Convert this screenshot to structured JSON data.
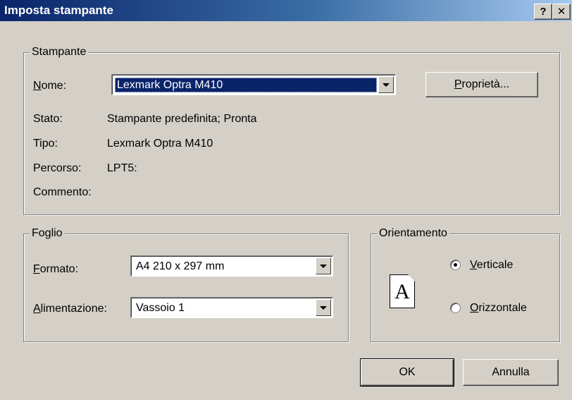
{
  "window": {
    "title": "Imposta stampante",
    "help_label": "?",
    "close_label": "✕"
  },
  "printer": {
    "group_label": "Stampante",
    "name_label_first": "N",
    "name_label_rest": "ome:",
    "name_value": "Lexmark Optra M410",
    "properties_first": "P",
    "properties_rest": "roprietà...",
    "status_label": "Stato:",
    "status_value": "Stampante predefinita; Pronta",
    "type_label": "Tipo:",
    "type_value": "Lexmark Optra M410",
    "path_label": "Percorso:",
    "path_value": "LPT5:",
    "comment_label": "Commento:"
  },
  "paper": {
    "group_label": "Foglio",
    "size_label_first": "F",
    "size_label_rest": "ormato:",
    "size_value": "A4 210 x 297 mm",
    "source_label_first": "A",
    "source_label_rest": "limentazione:",
    "source_value": "Vassoio 1"
  },
  "orientation": {
    "group_label": "Orientamento",
    "icon_letter": "A",
    "portrait_first": "V",
    "portrait_rest": "erticale",
    "landscape_first": "O",
    "landscape_rest": "rizzontale",
    "selected": "Verticale"
  },
  "buttons": {
    "ok": "OK",
    "cancel": "Annulla"
  }
}
